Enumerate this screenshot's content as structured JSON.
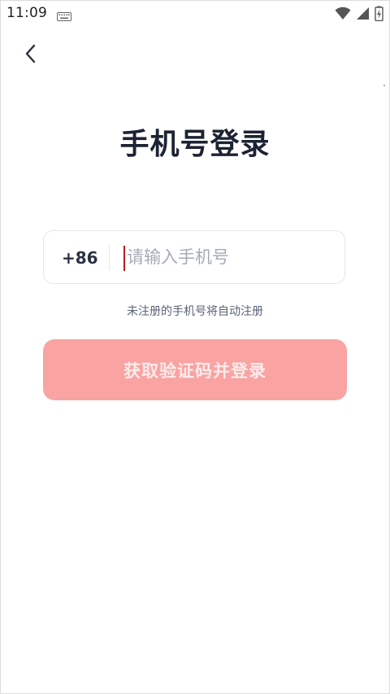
{
  "status_bar": {
    "time": "11:09",
    "icons": [
      "keyboard-icon",
      "wifi-icon",
      "signal-icon",
      "battery-charging-icon"
    ]
  },
  "nav": {
    "back_icon": "chevron-left-icon"
  },
  "title": "手机号登录",
  "phone": {
    "country_code": "+86",
    "placeholder": "请输入手机号",
    "value": ""
  },
  "hint": "未注册的手机号将自动注册",
  "submit": {
    "label": "获取验证码并登录",
    "color": "#f9a3a3"
  }
}
